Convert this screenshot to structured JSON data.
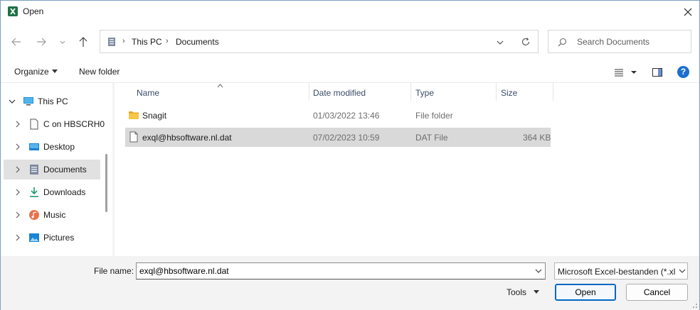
{
  "window": {
    "title": "Open"
  },
  "address": {
    "segments": [
      "This PC",
      "Documents"
    ]
  },
  "search": {
    "placeholder": "Search Documents"
  },
  "commands": {
    "organize": "Organize",
    "new_folder": "New folder"
  },
  "nav_tree": [
    {
      "label": "This PC",
      "expanded": true,
      "icon": "pc-icon"
    },
    {
      "label": "C on HBSCRH0",
      "icon": "drive-icon"
    },
    {
      "label": "Desktop",
      "icon": "desktop-icon"
    },
    {
      "label": "Documents",
      "icon": "documents-icon",
      "selected": true
    },
    {
      "label": "Downloads",
      "icon": "download-icon"
    },
    {
      "label": "Music",
      "icon": "music-icon"
    },
    {
      "label": "Pictures",
      "icon": "pictures-icon"
    }
  ],
  "columns": {
    "name": "Name",
    "date": "Date modified",
    "type": "Type",
    "size": "Size"
  },
  "files": [
    {
      "name": "Snagit",
      "date": "01/03/2022 13:46",
      "type": "File folder",
      "size": "",
      "icon": "folder-icon"
    },
    {
      "name": "exql@hbsoftware.nl.dat",
      "date": "07/02/2023 10:59",
      "type": "DAT File",
      "size": "364 KB",
      "icon": "file-icon",
      "selected": true
    }
  ],
  "bottom": {
    "file_name_label": "File name:",
    "file_name_value": "exql@hbsoftware.nl.dat",
    "filter": "Microsoft Excel-bestanden (*.xl",
    "tools": "Tools",
    "open": "Open",
    "cancel": "Cancel"
  },
  "colors": {
    "accent": "#0067c0",
    "selection": "#d9d9d9",
    "folder": "#f3c14a",
    "excel": "#1e7145"
  }
}
